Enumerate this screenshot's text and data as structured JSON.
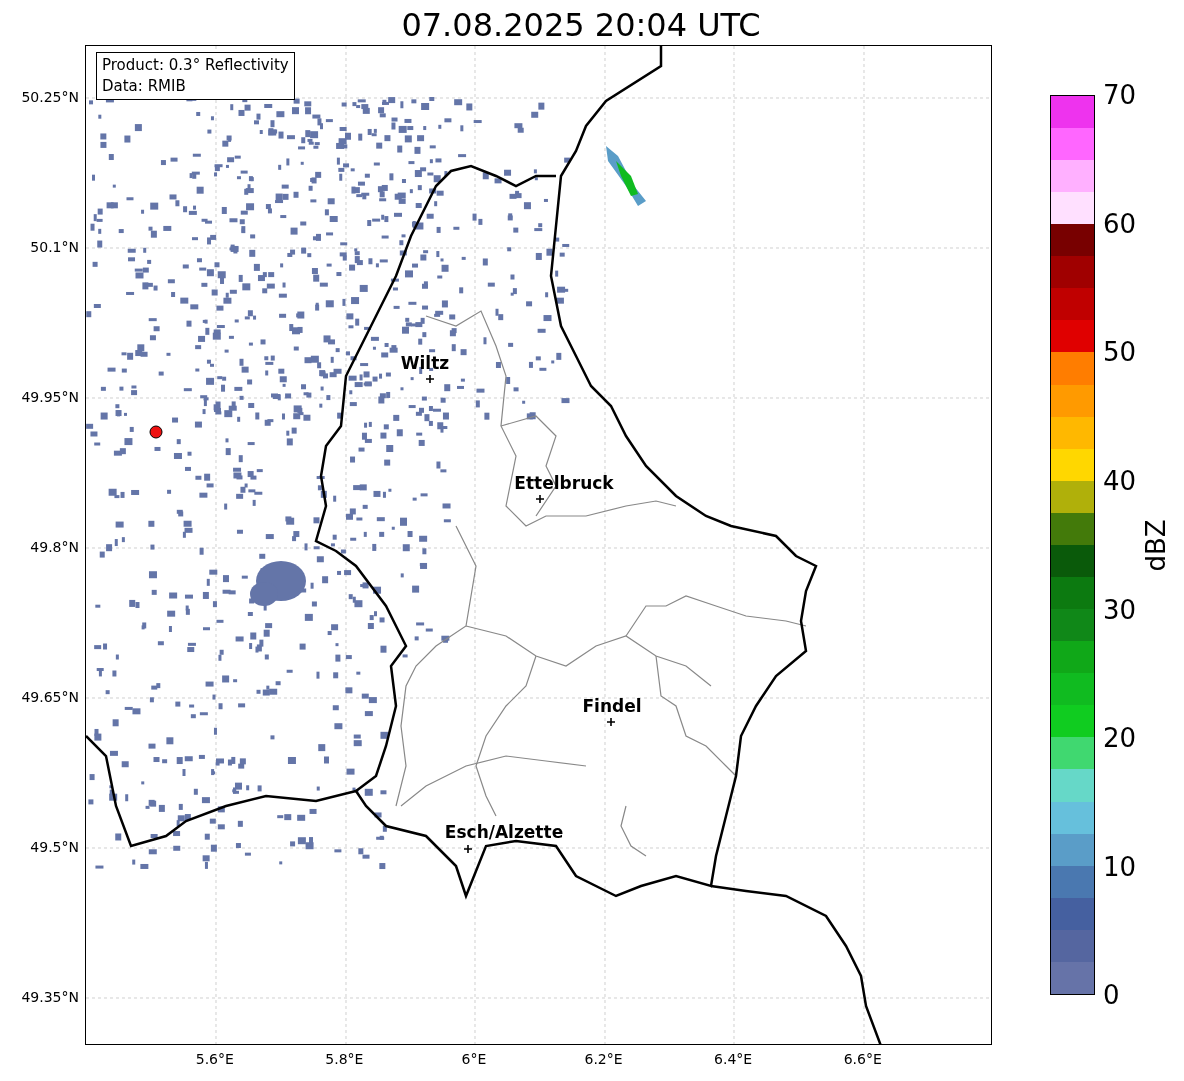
{
  "title": "07.08.2025 20:04 UTC",
  "info_box": [
    "Product: 0.3° Reflectivity",
    "Data: RMIB"
  ],
  "y_ticks": [
    "50.25°N",
    "50.1°N",
    "49.95°N",
    "49.8°N",
    "49.65°N",
    "49.5°N",
    "49.35°N"
  ],
  "x_ticks": [
    "5.6°E",
    "5.8°E",
    "6°E",
    "6.2°E",
    "6.4°E",
    "6.6°E"
  ],
  "cities": [
    {
      "name": "Wiltz"
    },
    {
      "name": "Ettelbruck"
    },
    {
      "name": "Findel"
    },
    {
      "name": "Esch/Alzette"
    }
  ],
  "colorbar": {
    "label": "dBZ",
    "ticks": [
      "70",
      "60",
      "50",
      "40",
      "30",
      "20",
      "10",
      "0"
    ],
    "bins": [
      {
        "color": "#6673a8"
      },
      {
        "color": "#5566a0"
      },
      {
        "color": "#4560a0"
      },
      {
        "color": "#4a78b0"
      },
      {
        "color": "#5a9dc8"
      },
      {
        "color": "#66c0dc"
      },
      {
        "color": "#66d8c8"
      },
      {
        "color": "#40d870"
      },
      {
        "color": "#10cc20"
      },
      {
        "color": "#10bb20"
      },
      {
        "color": "#10a818"
      },
      {
        "color": "#108818"
      },
      {
        "color": "#0c7a10"
      },
      {
        "color": "#0a5a0a"
      },
      {
        "color": "#437a0a"
      },
      {
        "color": "#b0b00a"
      },
      {
        "color": "#ffd700"
      },
      {
        "color": "#ffb800"
      },
      {
        "color": "#ff9a00"
      },
      {
        "color": "#ff7d00"
      },
      {
        "color": "#e00000"
      },
      {
        "color": "#c00000"
      },
      {
        "color": "#a00000"
      },
      {
        "color": "#780000"
      },
      {
        "color": "#ffe0ff"
      },
      {
        "color": "#ffb0ff"
      },
      {
        "color": "#ff66ff"
      },
      {
        "color": "#ee33ee"
      }
    ]
  }
}
